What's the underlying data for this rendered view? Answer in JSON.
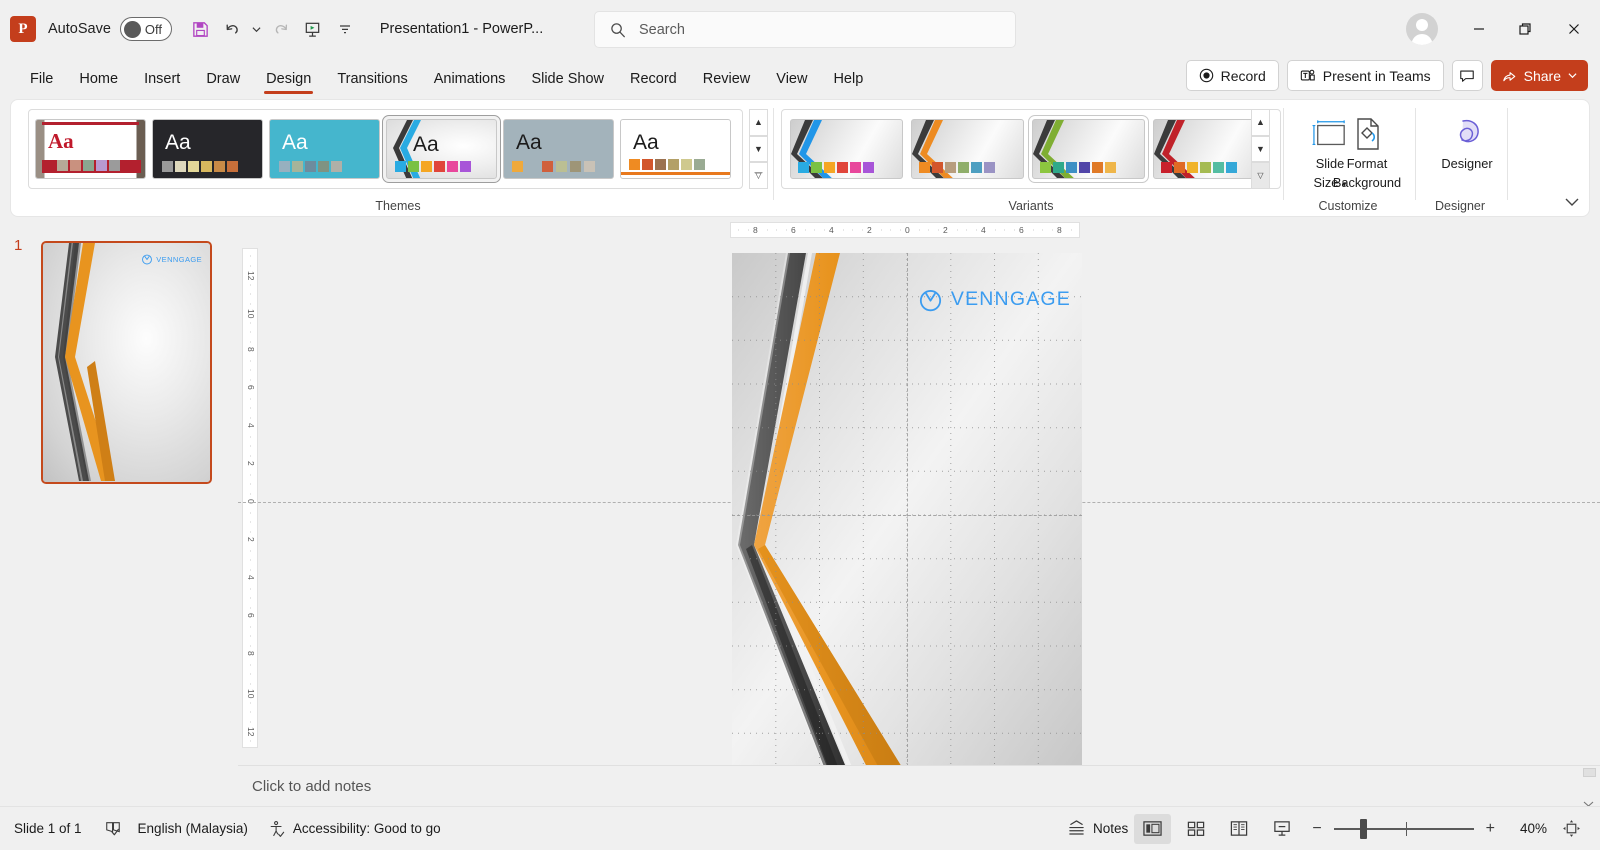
{
  "titlebar": {
    "app_icon": "powerpoint-logo",
    "autosave_label": "AutoSave",
    "autosave_state": "Off",
    "doc_title": "Presentation1  -  PowerP...",
    "qat": [
      {
        "name": "save-icon",
        "label": "Save"
      },
      {
        "name": "undo-icon",
        "label": "Undo"
      },
      {
        "name": "redo-icon",
        "label": "Redo"
      },
      {
        "name": "start-slideshow-icon",
        "label": "Start From Beginning"
      },
      {
        "name": "customize-quick-access-toolbar-icon",
        "label": "Customize Quick Access Toolbar"
      }
    ],
    "window_buttons": [
      {
        "name": "minimize-button",
        "glyph": "—"
      },
      {
        "name": "restore-button",
        "glyph": "❐"
      },
      {
        "name": "close-button",
        "glyph": "✕"
      }
    ]
  },
  "search": {
    "placeholder": "Search",
    "value": "",
    "icon": "search-icon"
  },
  "tabs": [
    {
      "label": "File",
      "active": false
    },
    {
      "label": "Home",
      "active": false
    },
    {
      "label": "Insert",
      "active": false
    },
    {
      "label": "Draw",
      "active": false
    },
    {
      "label": "Design",
      "active": true
    },
    {
      "label": "Transitions",
      "active": false
    },
    {
      "label": "Animations",
      "active": false
    },
    {
      "label": "Slide Show",
      "active": false
    },
    {
      "label": "Record",
      "active": false
    },
    {
      "label": "Review",
      "active": false
    },
    {
      "label": "View",
      "active": false
    },
    {
      "label": "Help",
      "active": false
    }
  ],
  "tab_actions": {
    "record_label": "Record",
    "present_in_teams_label": "Present in Teams",
    "comments_label": "Comments",
    "share_label": "Share",
    "share_color": "#c43e1c"
  },
  "ribbon": {
    "groups": [
      {
        "label": "Themes"
      },
      {
        "label": "Variants"
      },
      {
        "label": "Customize"
      },
      {
        "label": "Designer"
      }
    ],
    "themes": [
      {
        "name": "theme-office",
        "sample": "Aa",
        "bg": "#ffffff",
        "aa_color": "#c0192b",
        "accent": "#c0192b",
        "swatches": [
          "#b3202e",
          "#b6a997",
          "#c9917f",
          "#8aa68f",
          "#b89ad1",
          "#9b9b9b"
        ]
      },
      {
        "name": "theme-dark",
        "sample": "Aa",
        "bg": "#26262a",
        "aa_color": "#ffffff",
        "accent": "#26262a",
        "swatches": [
          "#9a9a9a",
          "#ded8bc",
          "#e4d898",
          "#d8b85e",
          "#c98a46",
          "#c76f3a"
        ]
      },
      {
        "name": "theme-cyan",
        "sample": "Aa",
        "bg": "#45b6cd",
        "aa_color": "#ffffff",
        "accent": "#45b6cd",
        "swatches": [
          "#97b0bf",
          "#a5b49a",
          "#6d8c9e",
          "#7f9382",
          "#b0b0a8"
        ]
      },
      {
        "name": "theme-facet-orange",
        "sample": "Aa",
        "bg": "#f4f4f4",
        "aa_color": "#1b1b1b",
        "accent": "#eb8c23",
        "selected": true,
        "swatches": [
          "#29abe2",
          "#7ac143",
          "#f5a623",
          "#e0453a",
          "#e8479c",
          "#a855d8"
        ]
      },
      {
        "name": "theme-slate",
        "sample": "Aa",
        "bg": "#a3b3bb",
        "aa_color": "#1b1b1b",
        "accent": "#a3b3bb",
        "swatches": [
          "#f0a93b",
          "#d0603c",
          "#bbbf93",
          "#9e9577",
          "#c9c2b6"
        ]
      },
      {
        "name": "theme-white-orange",
        "sample": "Aa",
        "bg": "#ffffff",
        "aa_color": "#1b1b1b",
        "accent": "#e8791e",
        "swatches": [
          "#ef8b22",
          "#d2562c",
          "#9c7250",
          "#b3a067",
          "#cfc98e",
          "#9aab93"
        ]
      }
    ],
    "themes_scroll": [
      {
        "name": "themes-scroll-up-button",
        "glyph": "▲"
      },
      {
        "name": "themes-scroll-down-button",
        "glyph": "▼"
      },
      {
        "name": "themes-more-button",
        "glyph": "☰"
      }
    ],
    "variants": [
      {
        "name": "variant-blue",
        "band_dark": "#3b3b3b",
        "band_color": "#2196e8",
        "swatches": [
          "#29abe2",
          "#7ac143",
          "#f5a623",
          "#e0453a",
          "#e8479c",
          "#a855d8"
        ]
      },
      {
        "name": "variant-orange",
        "band_dark": "#3b3b3b",
        "band_color": "#ed8b22",
        "swatches": [
          "#ef8b22",
          "#d2562c",
          "#b79d7e",
          "#8fae6a",
          "#4e9fc1",
          "#9a93c4"
        ]
      },
      {
        "name": "variant-green",
        "band_dark": "#3b3b3b",
        "band_color": "#7fae33",
        "hover": true,
        "swatches": [
          "#8cc63f",
          "#2fa98a",
          "#3d8fc4",
          "#5145a8",
          "#e07a27",
          "#efb64a"
        ]
      },
      {
        "name": "variant-red",
        "band_dark": "#3b3b3b",
        "band_color": "#c0222a",
        "swatches": [
          "#c8202c",
          "#e06a24",
          "#f0b32a",
          "#a5bb52",
          "#54bda2",
          "#35a8d8"
        ]
      }
    ],
    "variants_scroll": [
      {
        "name": "variants-scroll-up-button",
        "glyph": "▲"
      },
      {
        "name": "variants-scroll-down-button",
        "glyph": "▼"
      },
      {
        "name": "variants-more-button",
        "glyph": "☰"
      }
    ],
    "customize": {
      "slide_size_label_1": "Slide",
      "slide_size_label_2": "Size",
      "format_background_label_1": "Format",
      "format_background_label_2": "Background"
    },
    "designer": {
      "designer_label": "Designer"
    },
    "collapse_glyph": "⌄"
  },
  "slide_panel": {
    "slide_number": "1"
  },
  "ruler": {
    "horizontal_ticks": [
      "8",
      "6",
      "4",
      "2",
      "0",
      "2",
      "4",
      "6",
      "8"
    ],
    "vertical_ticks": [
      "12",
      "10",
      "8",
      "6",
      "4",
      "2",
      "0",
      "2",
      "4",
      "6",
      "8",
      "10",
      "12"
    ]
  },
  "slide": {
    "logo_text": "VENNGAGE",
    "logo_icon": "venngage-clock-icon",
    "logo_color": "#3b9cf0",
    "band_dark": "#4a4a4a",
    "band_orange": "#e8941f",
    "band_orange_dark": "#d3851a"
  },
  "notes": {
    "placeholder": "Click to add notes"
  },
  "statusbar": {
    "slide_count": "Slide 1 of 1",
    "spellcheck_icon": "spellcheck-icon",
    "language": "English (Malaysia)",
    "accessibility_icon": "accessibility-icon",
    "accessibility": "Accessibility: Good to go",
    "notes_label": "Notes",
    "views": [
      {
        "name": "view-normal",
        "active": true
      },
      {
        "name": "view-slide-sorter",
        "active": false
      },
      {
        "name": "view-reading",
        "active": false
      },
      {
        "name": "view-slideshow",
        "active": false
      }
    ],
    "zoom_out_glyph": "−",
    "zoom_in_glyph": "+",
    "zoom_value": "40%",
    "fit_slide_icon": "fit-slide-to-window-icon"
  }
}
